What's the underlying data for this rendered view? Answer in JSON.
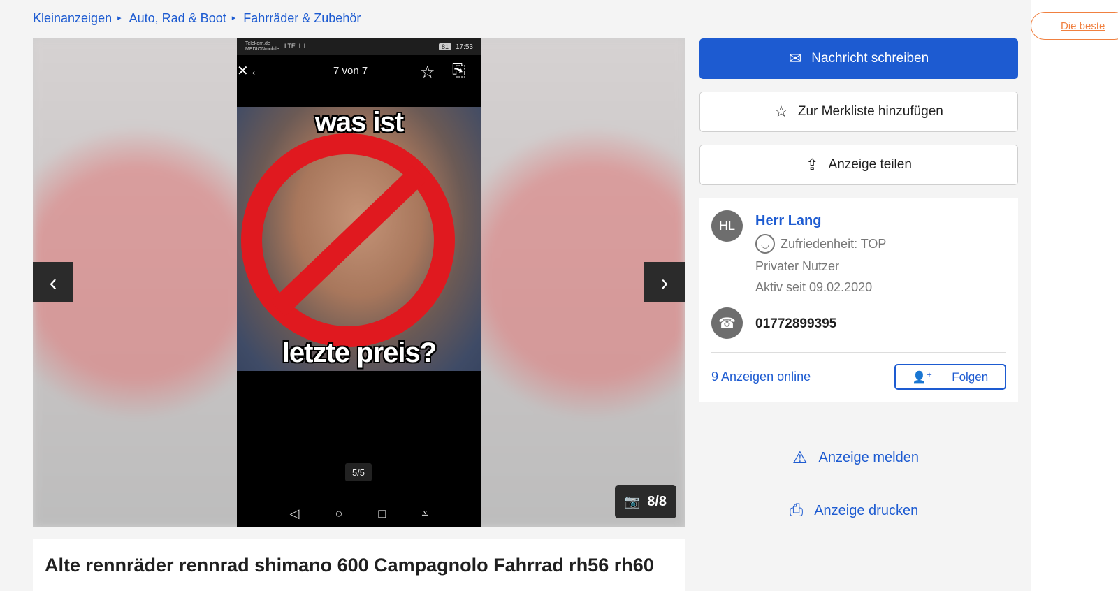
{
  "breadcrumb": [
    "Kleinanzeigen",
    "Auto, Rad & Boot",
    "Fahrräder & Zubehör"
  ],
  "breadcrumb_separator": "▸",
  "gallery": {
    "phone_status": {
      "carrier_line1": "Telekom.de",
      "carrier_line2": "MEDIONmobile",
      "signal": "LTE ıl ıl",
      "battery": "81",
      "time": "17:53"
    },
    "phone_counter": "7 von 7",
    "meme_top": "was ist",
    "meme_bottom": "letzte preis?",
    "pager": "5/5",
    "counter": "8/8"
  },
  "title": "Alte rennräder rennrad shimano 600 Campagnolo Fahrrad rh56 rh60",
  "actions": {
    "message": "Nachricht schreiben",
    "watchlist": "Zur Merkliste hinzufügen",
    "share": "Anzeige teilen"
  },
  "seller": {
    "initials": "HL",
    "name": "Herr Lang",
    "satisfaction": "Zufriedenheit: TOP",
    "type": "Privater Nutzer",
    "active_since": "Aktiv seit 09.02.2020",
    "phone": "01772899395",
    "ads_online": "9 Anzeigen online",
    "follow": "Folgen"
  },
  "links": {
    "report": "Anzeige melden",
    "print": "Anzeige drucken"
  },
  "edge_button": "Die beste",
  "colors": {
    "brand_blue": "#1d5bd1",
    "accent_orange": "#f08040"
  }
}
